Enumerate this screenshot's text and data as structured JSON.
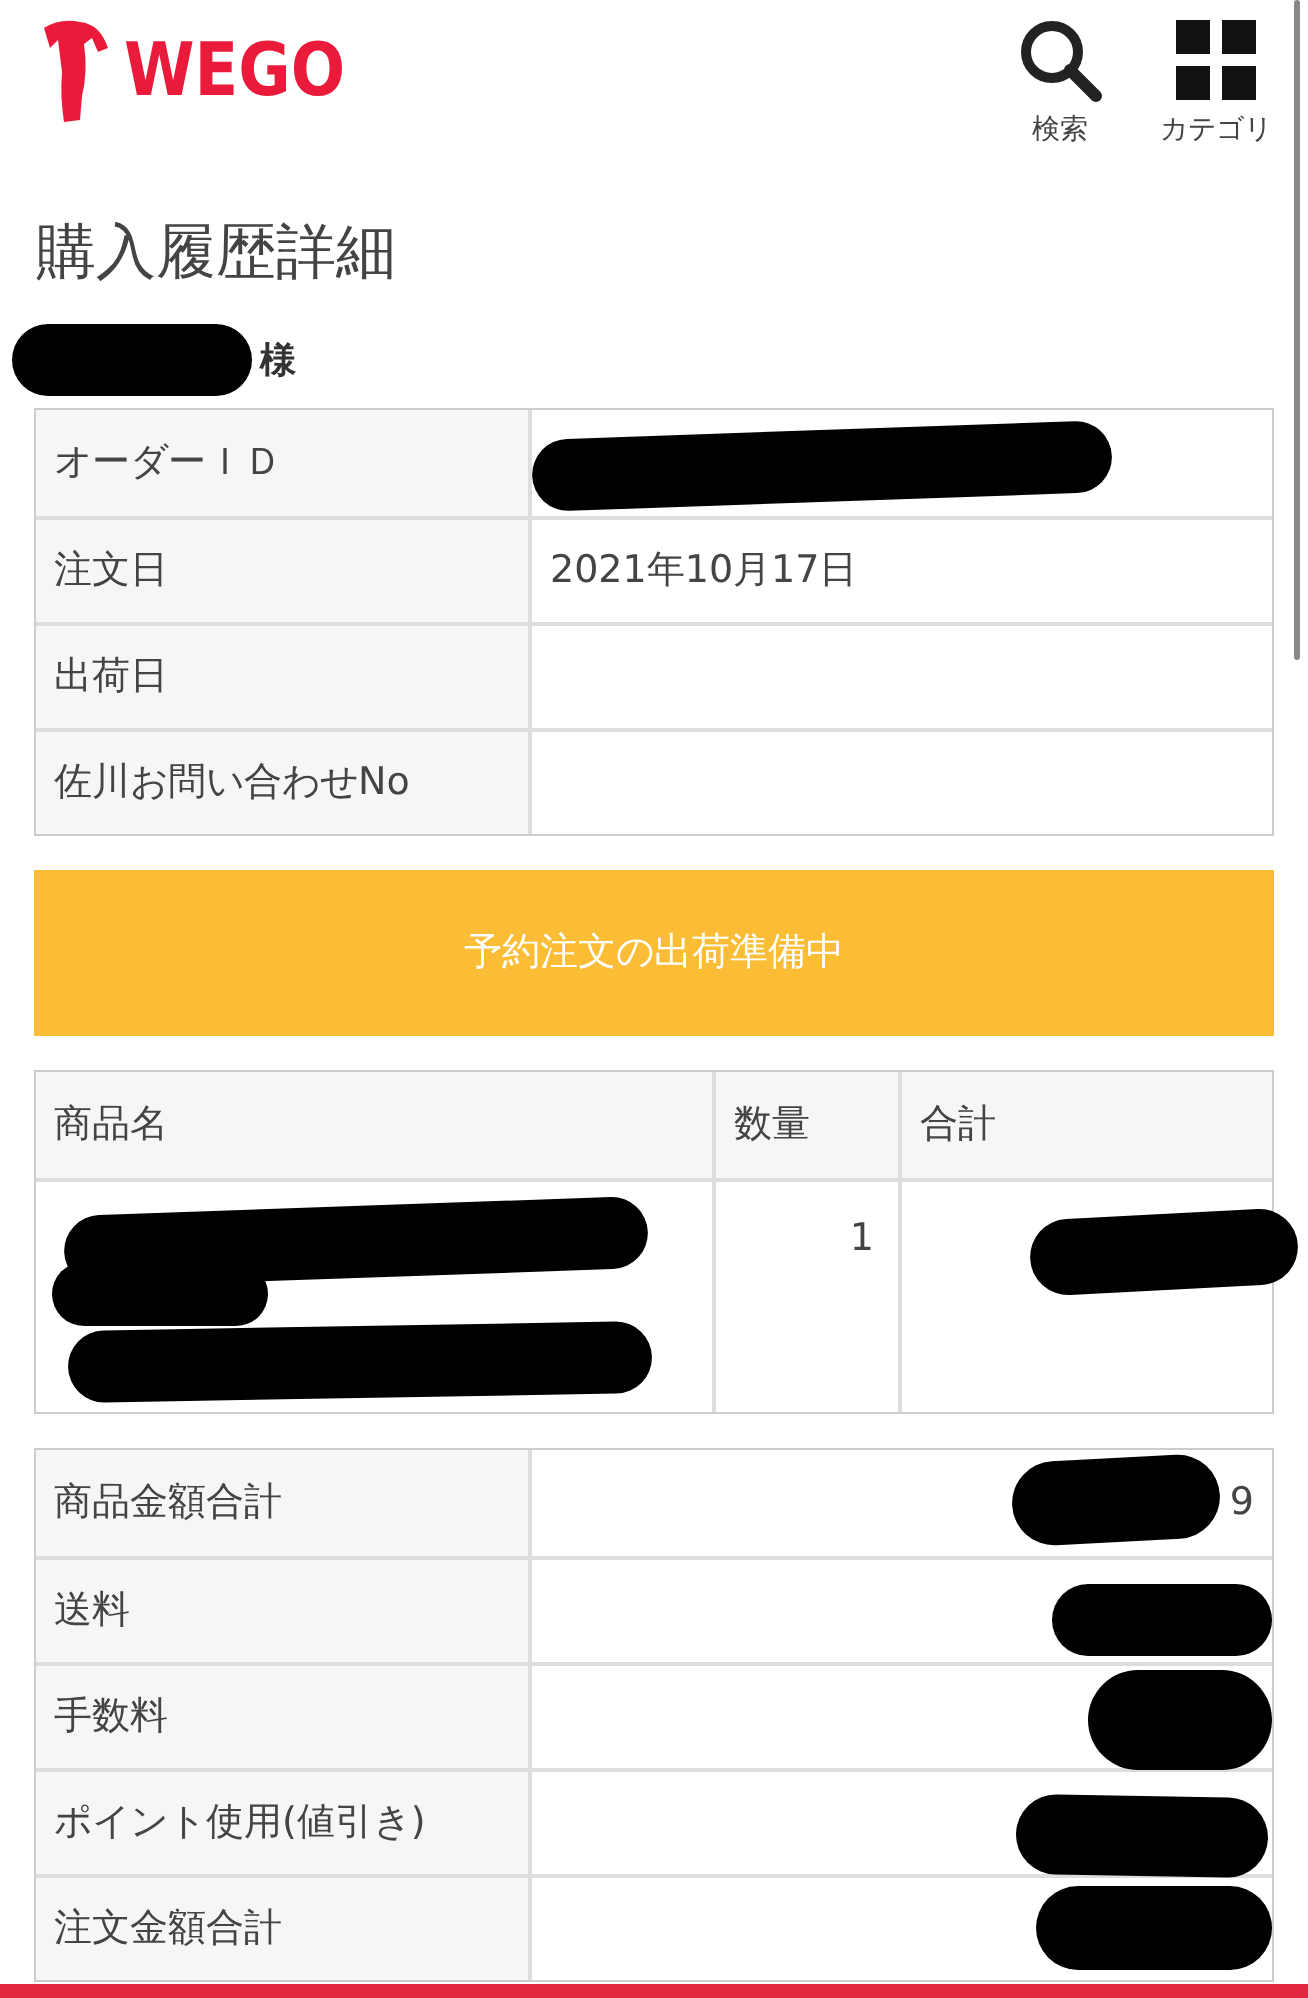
{
  "header": {
    "logo": "WEGO",
    "actions": [
      {
        "kind": "search",
        "label": "検索"
      },
      {
        "kind": "category",
        "label": "カテゴリ"
      }
    ]
  },
  "title": "購入履歴詳細",
  "customer": {
    "suffix": "様",
    "redacted": true
  },
  "order_info": [
    {
      "label": "オーダーＩＤ",
      "redacted": true
    },
    {
      "label": "注文日",
      "value": "2021年10月17日"
    },
    {
      "label": "出荷日"
    },
    {
      "label": "佐川お問い合わせNo"
    }
  ],
  "status_button": "予約注文の出荷準備中",
  "items_table": {
    "columns": [
      "商品名",
      "数量",
      "合計"
    ],
    "rows": [
      {
        "name_redacted": true,
        "quantity": "1",
        "total_redacted": true
      }
    ]
  },
  "totals": [
    {
      "label": "商品金額合計",
      "value": "9",
      "redacted": true
    },
    {
      "label": "送料",
      "redacted": true
    },
    {
      "label": "手数料",
      "redacted": true
    },
    {
      "label": "ポイント使用(値引き)",
      "redacted": true
    },
    {
      "label": "注文金額合計",
      "redacted": true
    }
  ]
}
